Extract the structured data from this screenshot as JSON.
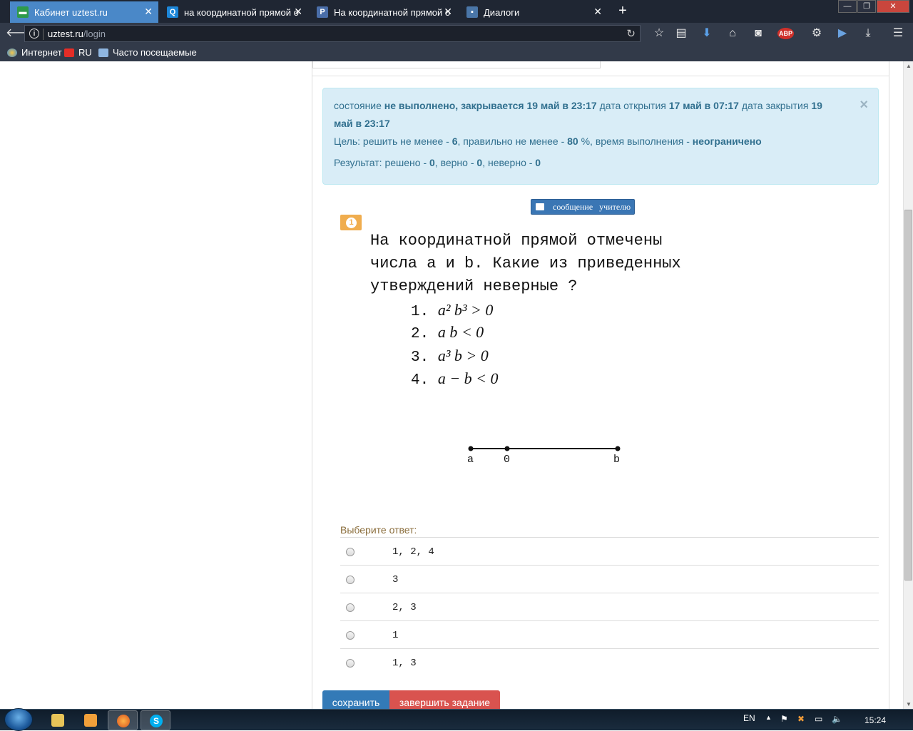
{
  "browser": {
    "tabs": [
      {
        "label": "Кабинет uztest.ru",
        "icon": "uztest-favicon"
      },
      {
        "label": "на координатной прямой о",
        "icon": "search-favicon"
      },
      {
        "label": "На координатной прямой о",
        "icon": "p-favicon"
      },
      {
        "label": "Диалоги",
        "icon": "dialogs-favicon"
      }
    ],
    "url_host": "uztest.ru",
    "url_path": "/login",
    "bookmarks": [
      "Интернет",
      "RU",
      "Часто посещаемые"
    ]
  },
  "status": {
    "prefix": "состояние",
    "state": "не выполнено, закрывается 19 май в 23:17",
    "open_label": "дата открытия",
    "open_date": "17 май в 07:17",
    "close_label": "дата закрытия",
    "close_date": "19 май в 23:17",
    "goal_prefix": "Цель: решить не менее -",
    "goal_count": "6",
    "goal_mid": ", правильно не менее -",
    "goal_percent": "80",
    "goal_mid2": "%, время выполнения -",
    "goal_time": "неограничено",
    "result_prefix": "Результат: решено -",
    "solved": "0",
    "correct_label": ", верно -",
    "correct": "0",
    "wrong_label": ", неверно -",
    "wrong": "0",
    "close_glyph": "×"
  },
  "message_button": "сообщение   учителю",
  "question": {
    "number": "1",
    "text": "На координатной прямой отмечены\nчисла a и b. Какие из приведенных\nутверждений неверные ?",
    "options": [
      {
        "num": "1.",
        "expr": "a² b³ > 0"
      },
      {
        "num": "2.",
        "expr": "a b < 0"
      },
      {
        "num": "3.",
        "expr": "a³ b > 0"
      },
      {
        "num": "4.",
        "expr": "a − b < 0"
      }
    ],
    "number_line": {
      "labels": [
        "a",
        "0",
        "b"
      ]
    }
  },
  "choose_label": "Выберите ответ:",
  "answers": [
    "1, 2, 4",
    "3",
    "2, 3",
    "1",
    "1, 3"
  ],
  "buttons": {
    "save": "сохранить",
    "finish": "завершить задание"
  },
  "taskbar": {
    "lang": "EN",
    "time": "15:24"
  }
}
